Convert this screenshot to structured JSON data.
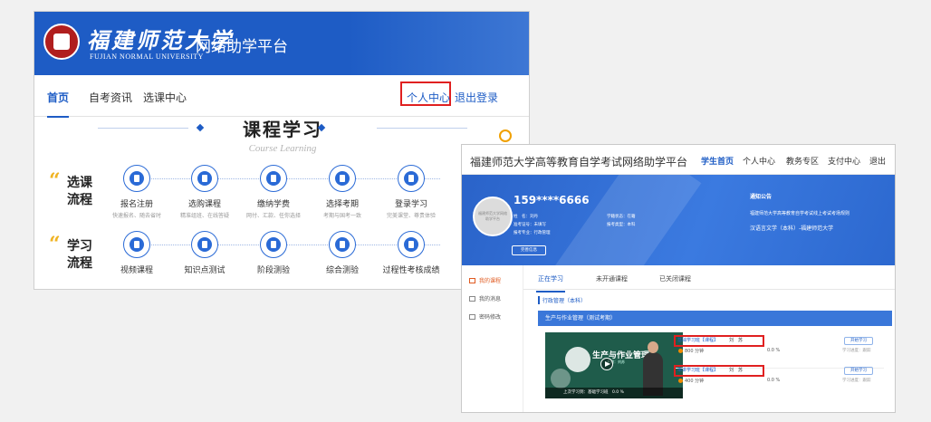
{
  "left": {
    "logo_cn": "福建师范大学",
    "logo_en": "FUJIAN NORMAL UNIVERSITY",
    "platform": "网络助学平台",
    "nav": {
      "home": "首页",
      "news": "自考资讯",
      "course_center": "选课中心",
      "personal_center": "个人中心",
      "logout": "退出登录"
    },
    "section_title": "课程学习",
    "section_sub": "Course Learning",
    "row1_label": "选课流程",
    "row2_label": "学习流程",
    "row1_steps": [
      {
        "label": "报名注册",
        "desc": "快速报名、随去省时",
        "icon": "user-icon"
      },
      {
        "label": "选购课程",
        "desc": "精准组班、在线答疑",
        "icon": "book-icon"
      },
      {
        "label": "缴纳学费",
        "desc": "网付、汇款、任你选择",
        "icon": "wallet-icon"
      },
      {
        "label": "选择考期",
        "desc": "考期与国考一致",
        "icon": "calendar-icon"
      },
      {
        "label": "登录学习",
        "desc": "完美课堂、尊贵体验",
        "icon": "monitor-icon"
      }
    ],
    "row2_steps": [
      {
        "label": "视频课程",
        "icon": "video-icon"
      },
      {
        "label": "知识点测试",
        "icon": "book-icon"
      },
      {
        "label": "阶段测验",
        "icon": "book-open-icon"
      },
      {
        "label": "综合测验",
        "icon": "flag-icon"
      },
      {
        "label": "过程性考核成绩",
        "icon": "document-icon"
      }
    ]
  },
  "right": {
    "title": "福建师范大学高等教育自学考试网络助学平台",
    "nav": [
      "学生首页",
      "个人中心",
      "教务专区",
      "支付中心",
      "退出"
    ],
    "phone": "159****6666",
    "avatar_text": "福建师范大学网络助学平台",
    "info": {
      "name": "姓　名：刘丹",
      "exam_no": "准考证号：未填写",
      "major": "报考专业：行政管理",
      "status": "学籍状态：在籍",
      "level": "报考类型：本科"
    },
    "edit_btn": "完善信息",
    "notice_title": "通知公告",
    "notice_line1": "福建师范大学高等教育自学考试线上考试考场规则",
    "notice_line2": "汉语言文学（本科）-福建师范大学",
    "sidebar": [
      "我的课程",
      "我的消息",
      "密码修改"
    ],
    "tabs": [
      "正在学习",
      "未开通课程",
      "已关闭课程"
    ],
    "crumb": "行政管理（本科）",
    "course_name": "生产与作业管理（测试考期）",
    "thumb_title": "生产与作业管理",
    "thumb_sub": "主讲：刘苏",
    "thumb_footer": "上次学习到：基础学习班　0.0 %",
    "lessons": [
      {
        "name": "基础学习班【课程】",
        "teacher": "刘　苏",
        "minutes": "800 分钟",
        "pct": "0.0 %",
        "btn": "开始学习",
        "progress": "学习进度：跟踪"
      },
      {
        "name": "串讲学习班【课程】",
        "teacher": "刘　苏",
        "minutes": "400 分钟",
        "pct": "0.0 %",
        "btn": "开始学习",
        "progress": "学习进度：跟踪"
      }
    ]
  }
}
